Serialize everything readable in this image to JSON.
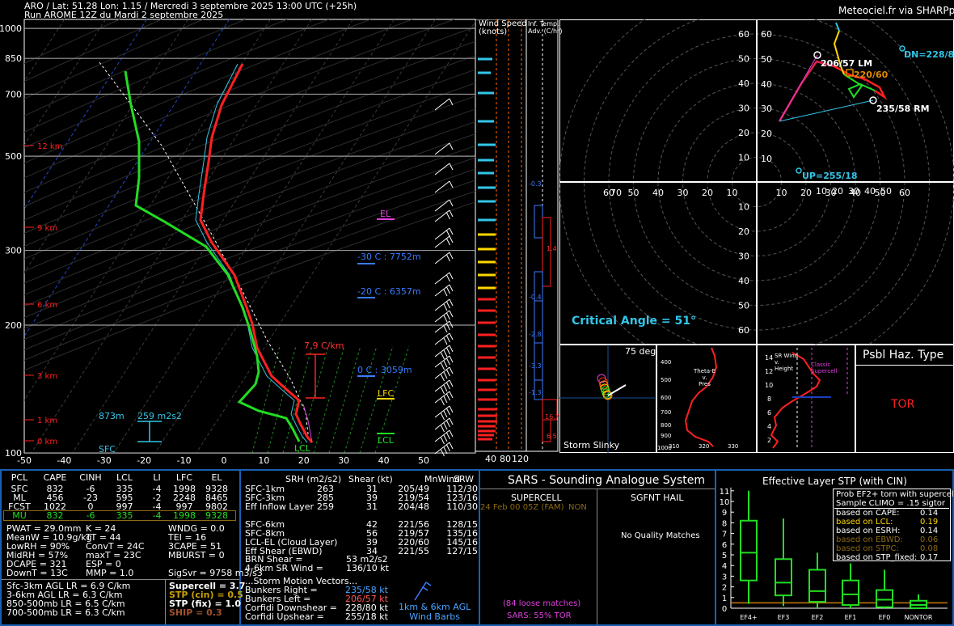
{
  "header": {
    "line1": "ARO / Lat: 51.28 Lon: 1.15 / Mercredi 3 septembre 2025 13:00 UTC (+25h)",
    "line2": "Run AROME 12Z du Mardi 2 septembre 2025",
    "credit": "Meteociel.fr via SHARPpy"
  },
  "chart_data": [
    {
      "type": "line",
      "name": "skewt",
      "pressure_ticks": [
        "100",
        "200",
        "300",
        "500",
        "700",
        "850",
        "1000"
      ],
      "temp_ticks": [
        "-50",
        "-40",
        "-30",
        "-20",
        "-10",
        "0",
        "10",
        "20",
        "30",
        "40",
        "50"
      ],
      "height_marks": [
        "12 km",
        "9 km",
        "6 km",
        "3 km",
        "1 km",
        "0 km"
      ],
      "series": [
        {
          "name": "temperature",
          "color": "#ff2020",
          "p": [
            1000,
            975,
            950,
            925,
            900,
            850,
            800,
            750,
            700,
            650,
            600,
            550,
            500,
            450,
            400,
            350,
            300,
            250,
            200,
            150,
            120,
            100
          ],
          "t": [
            19.5,
            17,
            15,
            14,
            12.5,
            10,
            5,
            0.5,
            -4,
            -8,
            -12.5,
            -17,
            -22,
            -28,
            -35,
            -43,
            -50,
            -55,
            -53,
            -54,
            -55,
            -56
          ]
        },
        {
          "name": "dewpoint",
          "color": "#22dd22",
          "p": [
            1000,
            975,
            950,
            925,
            900,
            850,
            800,
            750,
            700,
            650,
            600,
            550,
            500,
            450,
            400,
            350,
            300,
            250,
            200,
            150,
            120,
            100
          ],
          "t": [
            15,
            14,
            10,
            3,
            -2,
            -12,
            -10,
            -11,
            -12,
            -14,
            -17,
            -22,
            -27,
            -33,
            -40,
            -48,
            -60,
            -63,
            -66,
            -70,
            -72,
            -75
          ]
        }
      ],
      "annotations": {
        "el": "EL",
        "lfc": "LFC",
        "lcl": "LCL",
        "m30": "-30 C : 7752m",
        "m20": "-20 C : 6357m",
        "zero": "0 C : 3059m",
        "lapse": "7.9 C/km",
        "h873": "873m",
        "srh": "259 m2s2",
        "sfc": "SFC",
        "lcl_bottom": "LCL"
      }
    },
    {
      "type": "bar",
      "name": "wind_speed",
      "title": "Wind Speed\n(knots)",
      "x_ticks": [
        "40",
        "80",
        "120"
      ]
    },
    {
      "type": "line",
      "name": "inferred_temp_advection",
      "title": "Inf. Temp.\nAdv. (C/hr)",
      "values": [
        "-0.3",
        "1.4",
        "-0.4",
        "-2.8",
        "-3.3",
        "-1.3",
        "16.7",
        "6.5"
      ]
    },
    {
      "type": "line",
      "name": "hodograph",
      "rings": [
        "10",
        "20",
        "30",
        "40",
        "50",
        "60"
      ],
      "labels": {
        "lm": "206/57 LM",
        "mean": "220/60",
        "rm": "235/58 RM",
        "dn": "DN=228/80",
        "up": "UP=255/18"
      },
      "critical_angle": "Critical Angle = 51°"
    }
  ],
  "storm_slinky": {
    "label": "Storm Slinky",
    "deg": "75 deg"
  },
  "theta_e": {
    "label": "Theta-E\nv.\nPres",
    "x_ticks": [
      "310",
      "320",
      "330"
    ],
    "y_ticks": [
      "400",
      "500",
      "600",
      "700",
      "800",
      "900",
      "1000"
    ]
  },
  "srwind": {
    "label": "SR Wind\nv.\nHeight",
    "classic": "Classic\nSupercell",
    "y_ticks": [
      "14",
      "12",
      "10",
      "8",
      "6",
      "4",
      "2"
    ]
  },
  "hazard": {
    "title": "Psbl Haz. Type",
    "value": "TOR"
  },
  "parcels": {
    "header": [
      "PCL",
      "CAPE",
      "CINH",
      "LCL",
      "LI",
      "LFC",
      "EL"
    ],
    "rows": [
      [
        "SFC",
        "832",
        "-6",
        "335",
        "-4",
        "1998",
        "9328"
      ],
      [
        "ML",
        "456",
        "-23",
        "595",
        "-2",
        "2248",
        "8465"
      ],
      [
        "FCST",
        "1022",
        "0",
        "997",
        "-4",
        "997",
        "9802"
      ],
      [
        "MU",
        "832",
        "-6",
        "335",
        "-4",
        "1998",
        "9328"
      ]
    ]
  },
  "indices": [
    [
      "PWAT = 29.0mm",
      "K = 24",
      "WNDG = 0.0"
    ],
    [
      "MeanW = 10.9g/kg",
      "TT = 44",
      "TEI = 16"
    ],
    [
      "LowRH = 90%",
      "ConvT = 24C",
      "3CAPE = 51"
    ],
    [
      "MidRH = 57%",
      "maxT = 23C",
      "MBURST = 0"
    ],
    [
      "DCAPE = 321",
      "ESP = 0",
      ""
    ],
    [
      "DownT = 13C",
      "MMP = 1.0",
      "SigSvr = 9758 m3/s3"
    ]
  ],
  "lapse_rates": [
    "Sfc-3km AGL LR = 6.9 C/km",
    "3-6km AGL LR = 6.3 C/km",
    "850-500mb LR = 6.5 C/km",
    "700-500mb LR = 6.3 C/km"
  ],
  "composites": [
    {
      "label": "Supercell = 3.7",
      "color": "#ffffff"
    },
    {
      "label": "STP (cin) = 0.5",
      "color": "#c8a000"
    },
    {
      "label": "STP (fix) = 1.0",
      "color": "#ffffff"
    },
    {
      "label": "SHIP = 0.3",
      "color": "#a0522d"
    }
  ],
  "kinematics": {
    "header": [
      "SRH (m2/s2)",
      "Shear (kt)",
      "MnWind",
      "SRW"
    ],
    "rows": [
      [
        "SFC-1km",
        "263",
        "31",
        "205/49",
        "112/30"
      ],
      [
        "SFC-3km",
        "285",
        "39",
        "219/54",
        "123/16"
      ],
      [
        "Eff Inflow Layer",
        "259",
        "31",
        "204/48",
        "110/30"
      ],
      [
        "",
        "",
        "",
        "",
        ""
      ],
      [
        "SFC-6km",
        "",
        "42",
        "221/56",
        "128/15"
      ],
      [
        "SFC-8km",
        "",
        "56",
        "219/57",
        "135/16"
      ],
      [
        "LCL-EL (Cloud Layer)",
        "",
        "39",
        "220/60",
        "145/16"
      ],
      [
        "Eff Shear (EBWD)",
        "",
        "34",
        "221/55",
        "127/15"
      ]
    ],
    "brn_label": "BRN Shear =",
    "brn_val": "53 m2/s2",
    "sr4_label": "4-6km SR Wind =",
    "sr4_val": "136/10 kt",
    "motion_title": "...Storm Motion Vectors...",
    "motions": [
      {
        "label": "Bunkers Right =",
        "val": "235/58 kt",
        "color": "#4aa3ff"
      },
      {
        "label": "Bunkers Left =",
        "val": "206/57 kt",
        "color": "#ff5555"
      },
      {
        "label": "Corfidi Downshear =",
        "val": "228/80 kt",
        "color": "#ffffff"
      },
      {
        "label": "Corfidi Upshear =",
        "val": "255/18 kt",
        "color": "#ffffff"
      }
    ],
    "barbs_label": "1km & 6km AGL\nWind Barbs"
  },
  "sars": {
    "title": "SARS - Sounding Analogue System",
    "supercell": "SUPERCELL",
    "sgfnt": "SGFNT HAIL",
    "match": "24 Feb 00 05Z (FAM)",
    "match_type": "NON",
    "no_match": "No Quality Matches",
    "loose": "(84 loose matches)",
    "sars_pct": "SARS: 55% TOR"
  },
  "stp": {
    "title": "Effective Layer STP (with CIN)",
    "y_ticks": [
      "0",
      "1",
      "2",
      "3",
      "4",
      "5",
      "6",
      "7",
      "8",
      "9",
      "10",
      "11"
    ],
    "categories": [
      "EF4+",
      "EF3",
      "EF2",
      "EF1",
      "EF0",
      "NONTOR"
    ],
    "boxes": [
      {
        "min": 0.4,
        "q1": 2.6,
        "med": 5.2,
        "q3": 8.2,
        "max": 11
      },
      {
        "min": 0.2,
        "q1": 1.2,
        "med": 2.4,
        "q3": 4.6,
        "max": 8.4
      },
      {
        "min": 0,
        "q1": 0.6,
        "med": 1.6,
        "q3": 3.6,
        "max": 5.2
      },
      {
        "min": 0,
        "q1": 0.3,
        "med": 1.3,
        "q3": 2.6,
        "max": 4.2
      },
      {
        "min": 0,
        "q1": 0.1,
        "med": 0.8,
        "q3": 1.7,
        "max": 3.6
      },
      {
        "min": 0,
        "q1": 0,
        "med": 0.3,
        "q3": 0.7,
        "max": 1.3
      }
    ],
    "prob_title": "Prob EF2+ torn with supercell",
    "prob_sub": "Sample CLIMO = .15 sigtor",
    "prob_rows": [
      {
        "label": "based on CAPE:",
        "val": "0.14",
        "color": "#ffffff"
      },
      {
        "label": "based on LCL:",
        "val": "0.19",
        "color": "#ffd700"
      },
      {
        "label": "based on ESRH:",
        "val": "0.14",
        "color": "#ffffff"
      },
      {
        "label": "based on EBWD:",
        "val": "0.06",
        "color": "#8b6914"
      },
      {
        "label": "based on STPC:",
        "val": "0.08",
        "color": "#8b6914"
      },
      {
        "label": "based on STP_fixed:",
        "val": "0.17",
        "color": "#ffffff"
      }
    ]
  }
}
